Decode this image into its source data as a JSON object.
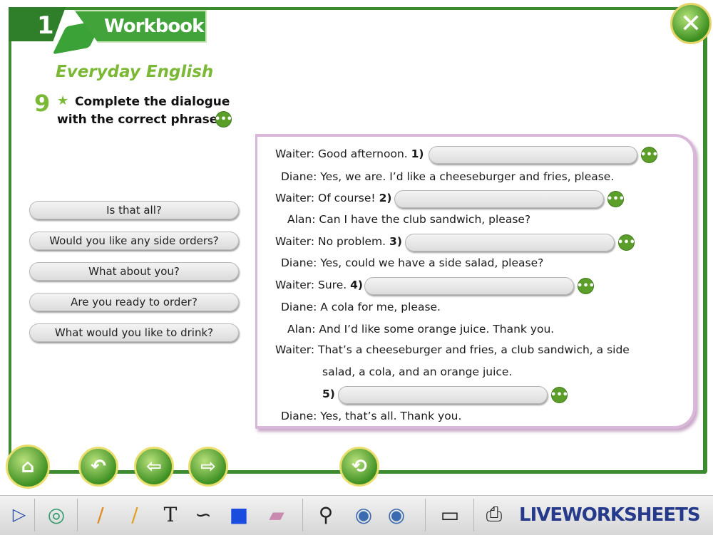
{
  "header": {
    "unit_number": "1",
    "tab_title": "Workbook",
    "close_icon": "close-icon"
  },
  "section_title": "Everyday English",
  "exercise": {
    "number": "9",
    "star": "★",
    "instruction": "Complete the dialogue with the correct phrases.",
    "help_button": "•••"
  },
  "phrases": [
    "Is that all?",
    "Would you like any side orders?",
    "What about you?",
    "Are you ready to order?",
    "What would you like to drink?"
  ],
  "dialogue": {
    "l1_speaker": "Waiter:",
    "l1_text": "Good afternoon.",
    "l1_num": "1)",
    "l2_speaker": "Diane:",
    "l2_text": "Yes, we are. I’d like a cheeseburger and fries, please.",
    "l3_speaker": "Waiter:",
    "l3_text": "Of course!",
    "l3_num": "2)",
    "l4_speaker": "Alan:",
    "l4_text": "Can I have the club sandwich, please?",
    "l5_speaker": "Waiter:",
    "l5_text": "No problem.",
    "l5_num": "3)",
    "l6_speaker": "Diane:",
    "l6_text": "Yes, could we have a side salad, please?",
    "l7_speaker": "Waiter:",
    "l7_text": "Sure.",
    "l7_num": "4)",
    "l8_speaker": "Diane:",
    "l8_text": "A cola for me, please.",
    "l9_speaker": "Alan:",
    "l9_text": "And I’d like some orange juice. Thank you.",
    "l10_speaker": "Waiter:",
    "l10_text": "That’s a cheeseburger and fries, a club sandwich, a side",
    "l11_text": "salad, a cola, and an orange juice.",
    "l12_num": "5)",
    "l13_speaker": "Diane:",
    "l13_text": "Yes, that’s all. Thank you.",
    "answer_button": "•••"
  },
  "nav": {
    "home_icon": "home-icon",
    "back_icon": "undo-arrow-icon",
    "prev_icon": "left-arrow-icon",
    "next_icon": "right-arrow-icon",
    "reset_icon": "refresh-icon"
  },
  "toolbar": {
    "brand": "LIVEWORKSHEETS",
    "text_tool": "T"
  },
  "colors": {
    "frame_green": "#3d8b2f",
    "accent_green": "#7ab835",
    "dialogue_border": "#d9b7d9",
    "button_green": "#5c9e2a"
  }
}
